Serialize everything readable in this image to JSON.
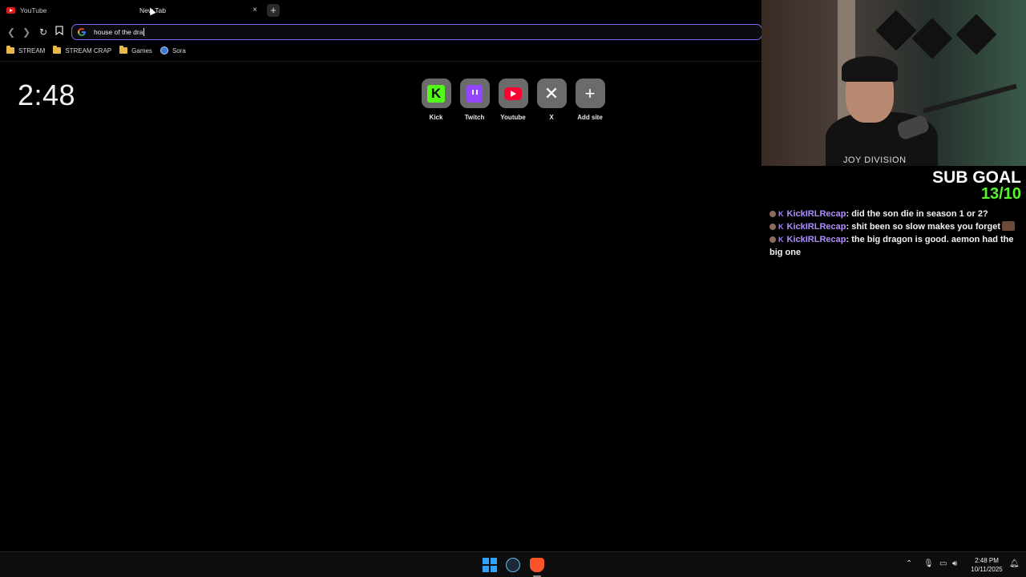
{
  "browser": {
    "tabs": [
      {
        "label": "YouTube",
        "active": false
      },
      {
        "label": "New Tab",
        "active": true
      }
    ],
    "tab_close": "×",
    "new_tab": "+",
    "omnibox": {
      "value": "house of the dra"
    },
    "bookmarks": [
      {
        "label": "STREAM",
        "icon": "folder-icon"
      },
      {
        "label": "STREAM CRAP",
        "icon": "folder-icon"
      },
      {
        "label": "Games",
        "icon": "folder-icon"
      },
      {
        "label": "Sora",
        "icon": "sora-icon"
      }
    ]
  },
  "newtab": {
    "clock": "2:48",
    "shortcuts": [
      {
        "label": "Kick",
        "icon": "kick-icon"
      },
      {
        "label": "Twitch",
        "icon": "twitch-icon"
      },
      {
        "label": "Youtube",
        "icon": "youtube-icon"
      },
      {
        "label": "X",
        "icon": "x-icon"
      },
      {
        "label": "Add site",
        "icon": "plus-icon"
      }
    ]
  },
  "overlay": {
    "webcam_shirt_text": "JOY DIVISION",
    "sub_goal": {
      "title": "SUB GOAL",
      "value": "13/10"
    },
    "chat": [
      {
        "user": "KickIRLRecap",
        "message": ": did the son die in season 1 or 2?"
      },
      {
        "user": "KickIRLRecap",
        "message": ": shit been so slow makes you forget"
      },
      {
        "user": "KickIRLRecap",
        "message": ": the big dragon is good. aemon had the big one"
      }
    ]
  },
  "taskbar": {
    "time": "2:48 PM",
    "date": "10/11/2025",
    "apps": [
      "windows-start-icon",
      "steam-icon",
      "brave-icon"
    ]
  },
  "colors": {
    "accent_omnibox": "#7c6df0",
    "subgoal_green": "#59f22e",
    "chat_user": "#b08cff",
    "kick_green": "#53fc18",
    "twitch_purple": "#9146ff",
    "youtube_red": "#ff0033"
  }
}
